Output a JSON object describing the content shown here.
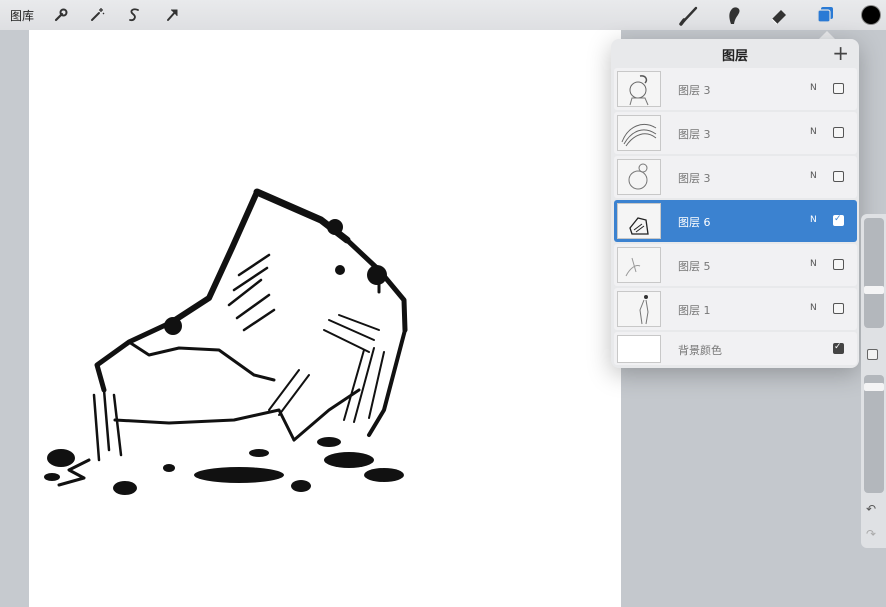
{
  "toolbar": {
    "gallery_label": "图库",
    "left_tools": [
      "wrench-icon",
      "magic-wand-icon",
      "selection-icon",
      "transform-arrow-icon"
    ],
    "right_tools": [
      "brush-icon",
      "smudge-icon",
      "eraser-icon",
      "layers-icon"
    ],
    "current_color": "#000000",
    "accent": "#2a7ad5"
  },
  "layers_panel": {
    "title": "图层",
    "add_label": "+",
    "layers": [
      {
        "name": "图层 3",
        "blend": "N",
        "visible": false,
        "selected": false
      },
      {
        "name": "图层 3",
        "blend": "N",
        "visible": false,
        "selected": false
      },
      {
        "name": "图层 3",
        "blend": "N",
        "visible": false,
        "selected": false
      },
      {
        "name": "图层 6",
        "blend": "N",
        "visible": true,
        "selected": true
      },
      {
        "name": "图层 5",
        "blend": "N",
        "visible": false,
        "selected": false
      },
      {
        "name": "图层 1",
        "blend": "N",
        "visible": false,
        "selected": false
      }
    ],
    "background": {
      "name": "背景颜色",
      "visible": true
    }
  },
  "sidebar": {
    "undo_label": "↶",
    "redo_label": "↷"
  }
}
